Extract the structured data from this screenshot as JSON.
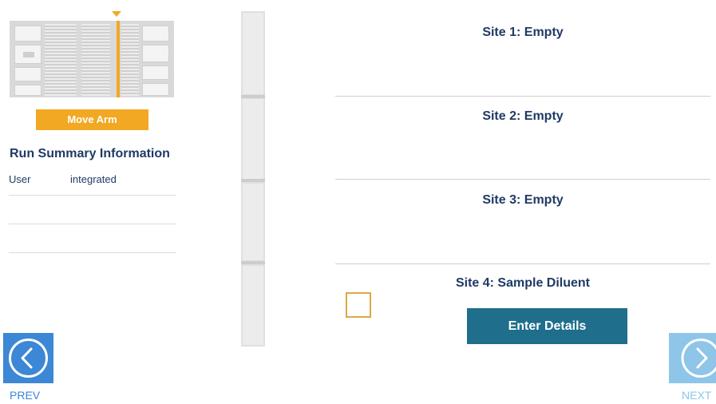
{
  "left_panel": {
    "move_arm_label": "Move Arm",
    "summary_title": "Run Summary Information",
    "summary_rows": [
      {
        "key": "User",
        "value": "integrated"
      },
      {
        "key": "",
        "value": ""
      },
      {
        "key": "",
        "value": ""
      }
    ]
  },
  "sites": [
    {
      "title": "Site 1: Empty"
    },
    {
      "title": "Site 2: Empty"
    },
    {
      "title": "Site 3: Empty"
    },
    {
      "title": "Site 4: Sample Diluent",
      "action_label": "Enter Details"
    }
  ],
  "nav": {
    "prev_label": "PREV",
    "next_label": "NEXT",
    "prev_icon": "chevron-left-circle-icon",
    "next_icon": "chevron-right-circle-icon"
  },
  "colors": {
    "accent_orange": "#f2a822",
    "primary_blue": "#3c87d6",
    "teal_button": "#1f6e8c",
    "text_navy": "#1f3a66"
  }
}
